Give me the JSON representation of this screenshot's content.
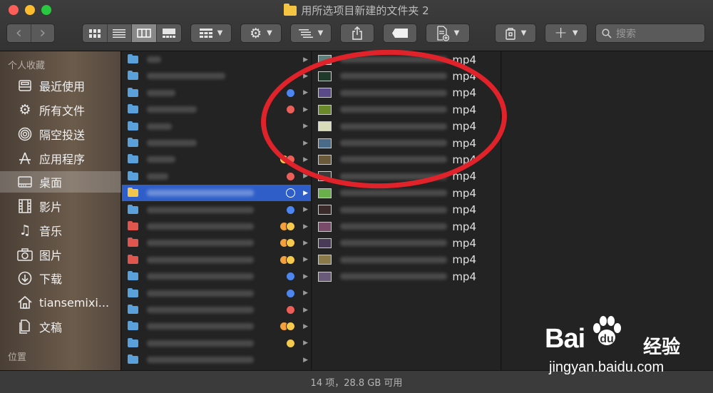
{
  "window": {
    "title": "用所选项目新建的文件夹 2"
  },
  "toolbar": {
    "back": "‹",
    "forward": "›",
    "gear": "⚙",
    "add": "+",
    "search_placeholder": "搜索"
  },
  "sidebar": {
    "favorites_header": "个人收藏",
    "locations_header": "位置",
    "items": [
      {
        "label": "最近使用",
        "icon": "recents-icon"
      },
      {
        "label": "所有文件",
        "icon": "all-files-icon"
      },
      {
        "label": "隔空投送",
        "icon": "airdrop-icon"
      },
      {
        "label": "应用程序",
        "icon": "applications-icon"
      },
      {
        "label": "桌面",
        "icon": "desktop-icon",
        "selected": true
      },
      {
        "label": "影片",
        "icon": "movies-icon"
      },
      {
        "label": "音乐",
        "icon": "music-icon"
      },
      {
        "label": "图片",
        "icon": "pictures-icon"
      },
      {
        "label": "下载",
        "icon": "downloads-icon"
      },
      {
        "label": "tiansemixi...",
        "icon": "home-icon"
      },
      {
        "label": "文稿",
        "icon": "documents-icon"
      }
    ]
  },
  "column1": {
    "rows": [
      {
        "folder_color": "#5aa1dc",
        "tags": []
      },
      {
        "folder_color": "#5aa1dc",
        "tags": []
      },
      {
        "folder_color": "#5aa1dc",
        "tags": [
          "blue"
        ]
      },
      {
        "folder_color": "#5aa1dc",
        "tags": [
          "red"
        ]
      },
      {
        "folder_color": "#5aa1dc",
        "tags": []
      },
      {
        "folder_color": "#5aa1dc",
        "tags": []
      },
      {
        "folder_color": "#5aa1dc",
        "tags": [
          "yellow",
          "red"
        ]
      },
      {
        "folder_color": "#5aa1dc",
        "tags": [
          "red"
        ]
      },
      {
        "folder_color": "#f3c54a",
        "tags": [
          "hollow"
        ],
        "selected": true
      },
      {
        "folder_color": "#5aa1dc",
        "tags": [
          "blue"
        ]
      },
      {
        "folder_color": "#e0564f",
        "tags": [
          "orange",
          "yellow"
        ]
      },
      {
        "folder_color": "#e0564f",
        "tags": [
          "orange",
          "yellow"
        ]
      },
      {
        "folder_color": "#e0564f",
        "tags": [
          "orange",
          "yellow"
        ]
      },
      {
        "folder_color": "#5aa1dc",
        "tags": [
          "blue"
        ]
      },
      {
        "folder_color": "#5aa1dc",
        "tags": [
          "blue"
        ]
      },
      {
        "folder_color": "#5aa1dc",
        "tags": [
          "red"
        ]
      },
      {
        "folder_color": "#5aa1dc",
        "tags": [
          "orange",
          "yellow"
        ]
      },
      {
        "folder_color": "#5aa1dc",
        "tags": [
          "yellow"
        ]
      },
      {
        "folder_color": "#5aa1dc",
        "tags": []
      }
    ]
  },
  "column2": {
    "file_ext": "mp4",
    "count": 14
  },
  "status": {
    "text": "14 项，28.8 GB 可用"
  },
  "watermark": {
    "brand": "Bai  经验",
    "brand_cn": "经验",
    "url": "jingyan.baidu.com"
  },
  "colors": {
    "annotation": "#e0222a",
    "selection": "#2f5ec9"
  }
}
